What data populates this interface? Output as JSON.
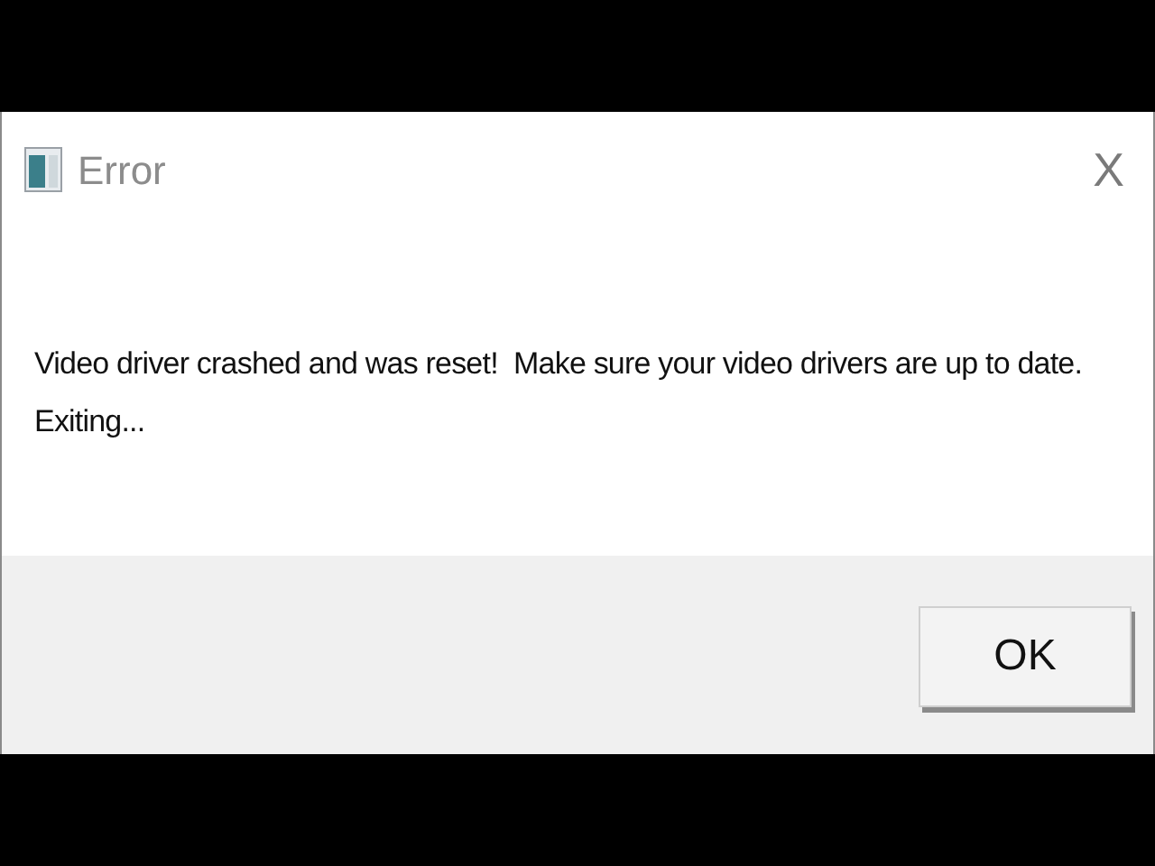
{
  "window": {
    "title": "Error",
    "close": "X"
  },
  "message": [
    "Video driver crashed and was reset!  Make sure your video drivers are up to date.",
    "Exiting..."
  ],
  "buttons": [
    "OK"
  ]
}
